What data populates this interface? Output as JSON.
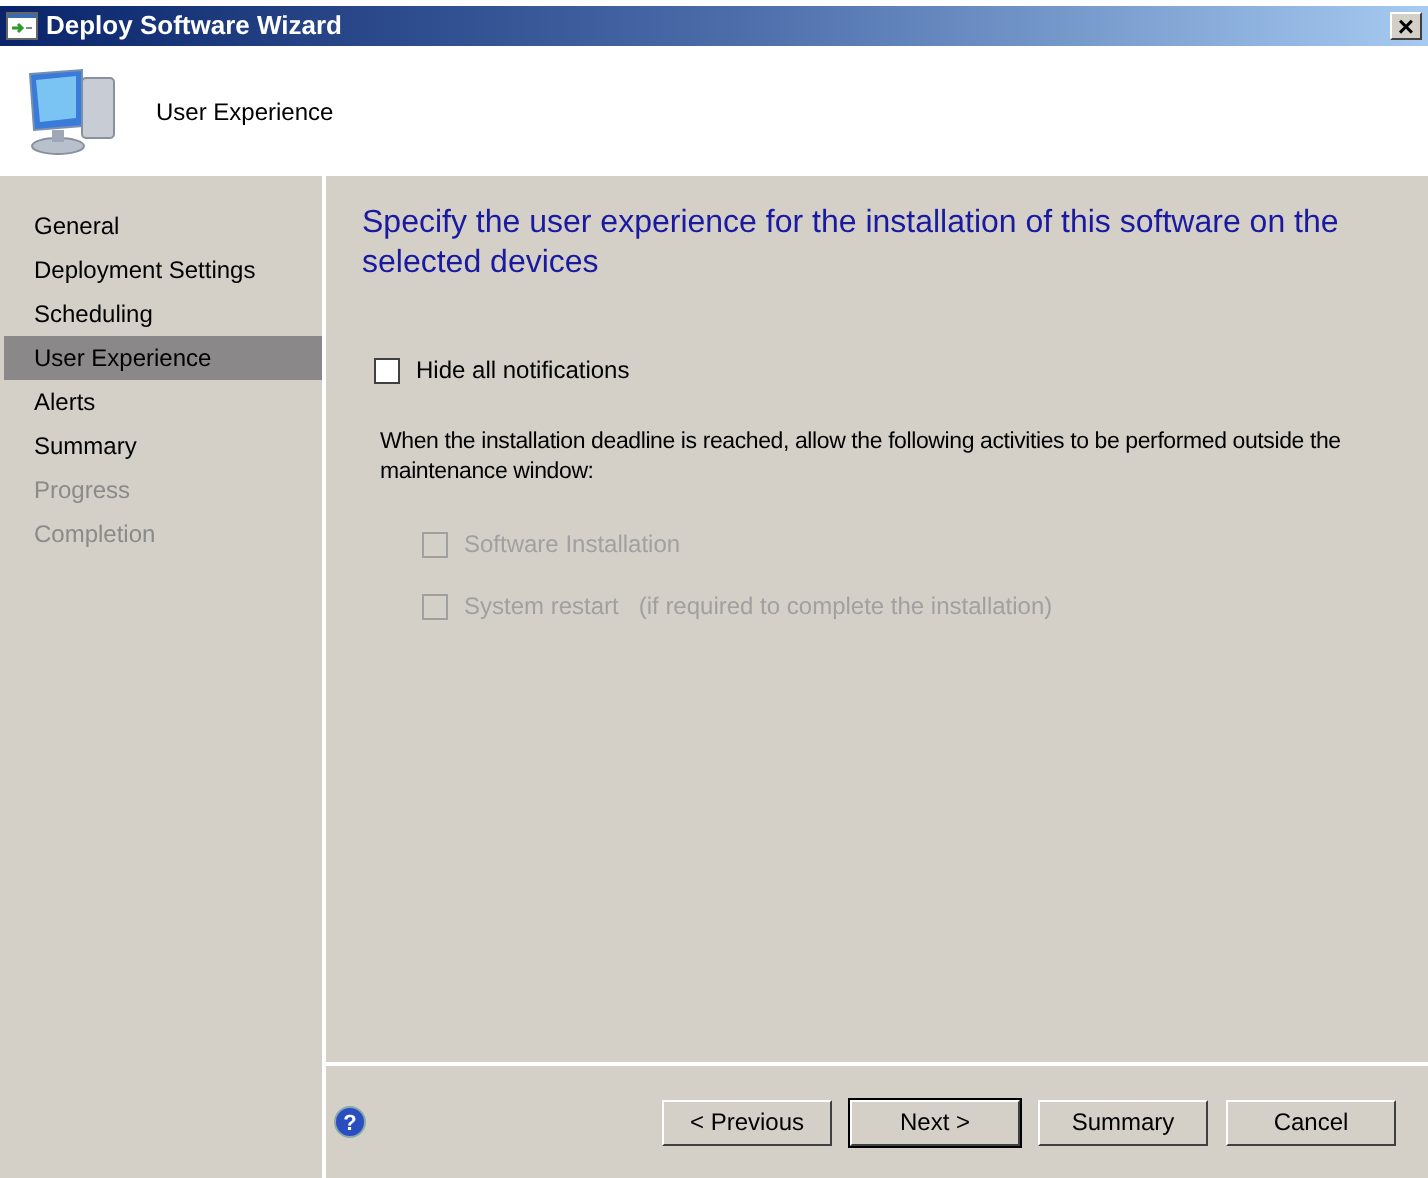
{
  "window": {
    "title": "Deploy Software Wizard",
    "close": "×"
  },
  "header": {
    "title": "User Experience"
  },
  "sidebar": {
    "items": [
      {
        "label": "General",
        "selected": false,
        "disabled": false
      },
      {
        "label": "Deployment Settings",
        "selected": false,
        "disabled": false
      },
      {
        "label": "Scheduling",
        "selected": false,
        "disabled": false
      },
      {
        "label": "User Experience",
        "selected": true,
        "disabled": false
      },
      {
        "label": "Alerts",
        "selected": false,
        "disabled": false
      },
      {
        "label": "Summary",
        "selected": false,
        "disabled": false
      },
      {
        "label": "Progress",
        "selected": false,
        "disabled": true
      },
      {
        "label": "Completion",
        "selected": false,
        "disabled": true
      }
    ]
  },
  "page": {
    "heading": "Specify the user experience for the installation of this software on the selected devices",
    "hide_notifications": {
      "label": "Hide all notifications",
      "checked": false,
      "disabled": false
    },
    "description": "When the installation deadline is reached, allow the following activities to be performed outside the maintenance window:",
    "activities": [
      {
        "label": "Software Installation",
        "checked": false,
        "disabled": true
      },
      {
        "label": "System restart",
        "note": "(if required to complete the installation)",
        "checked": false,
        "disabled": true
      }
    ]
  },
  "buttons": [
    {
      "label": "< Previous",
      "default": false
    },
    {
      "label": "Next >",
      "default": true
    },
    {
      "label": "Summary",
      "default": false
    },
    {
      "label": "Cancel",
      "default": false
    }
  ],
  "help": {
    "label": "?"
  }
}
